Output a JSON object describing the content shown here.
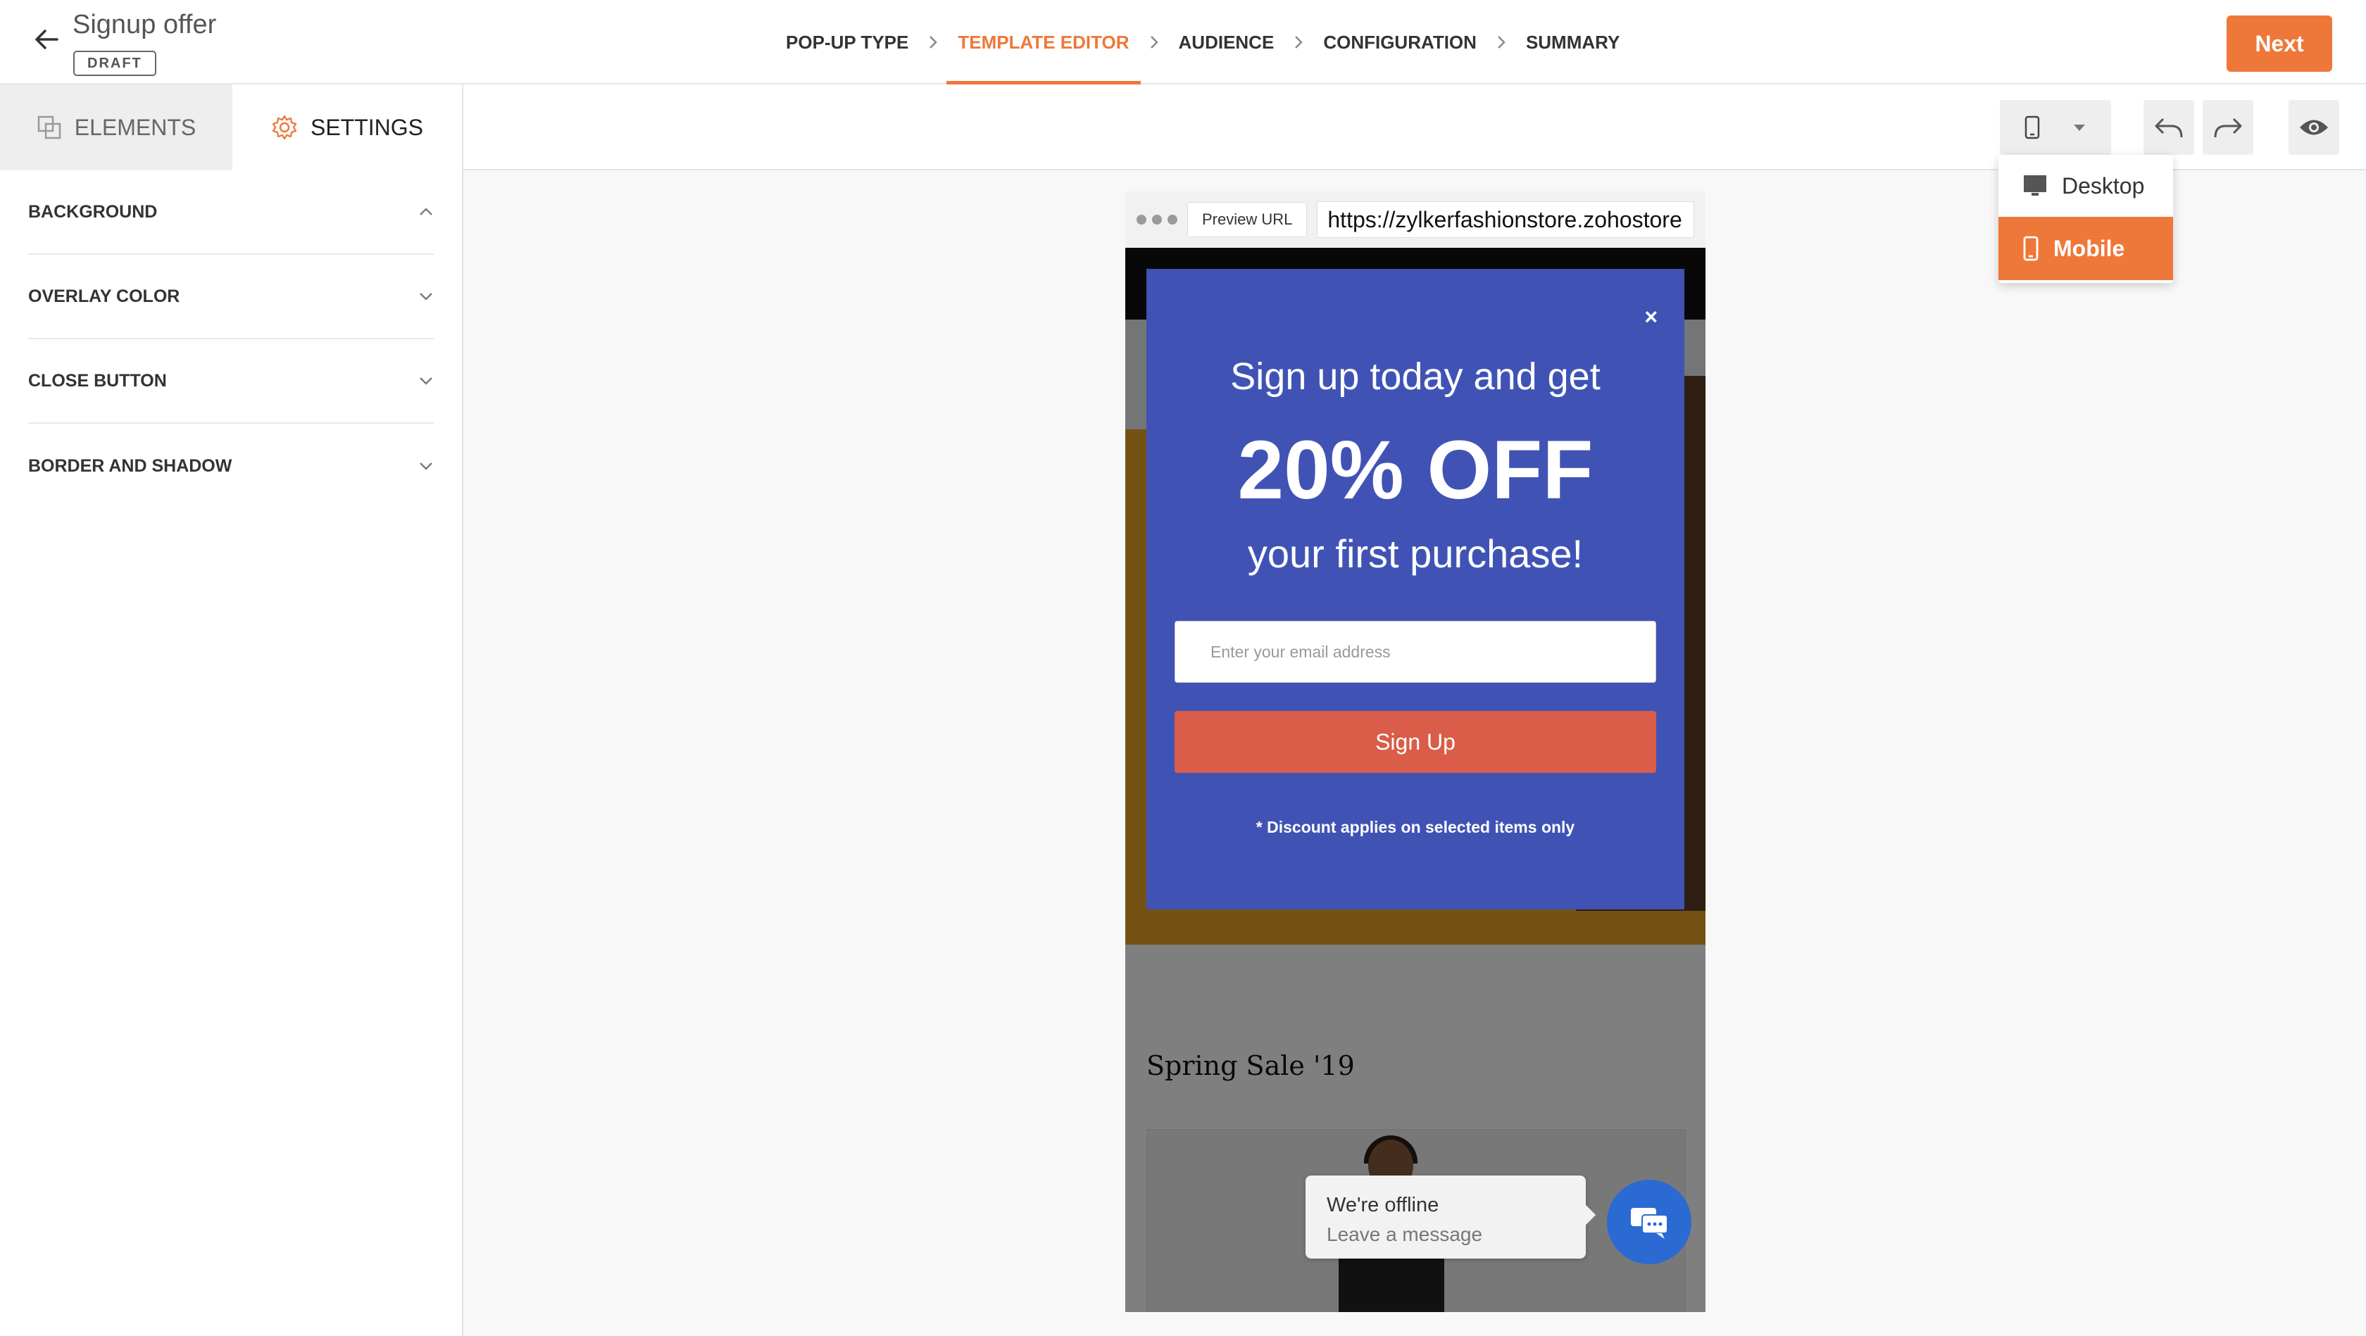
{
  "header": {
    "title": "Signup offer",
    "status_badge": "DRAFT",
    "steps": [
      {
        "label": "POP-UP TYPE"
      },
      {
        "label": "TEMPLATE EDITOR"
      },
      {
        "label": "AUDIENCE"
      },
      {
        "label": "CONFIGURATION"
      },
      {
        "label": "SUMMARY"
      }
    ],
    "active_step": "TEMPLATE EDITOR",
    "next_label": "Next"
  },
  "sidebar": {
    "tabs": [
      {
        "label": "ELEMENTS",
        "icon": "layers-icon"
      },
      {
        "label": "SETTINGS",
        "icon": "gear-icon"
      }
    ],
    "active_tab": "SETTINGS",
    "sections": [
      {
        "label": "BACKGROUND",
        "state": "expanded"
      },
      {
        "label": "OVERLAY COLOR",
        "state": "collapsed"
      },
      {
        "label": "CLOSE BUTTON",
        "state": "collapsed"
      },
      {
        "label": "BORDER AND SHADOW",
        "state": "collapsed"
      }
    ]
  },
  "toolbar": {
    "device_icon": "mobile-icon",
    "undo_icon": "undo-icon",
    "redo_icon": "redo-icon",
    "preview_icon": "eye-icon"
  },
  "device_menu": {
    "items": [
      {
        "label": "Desktop",
        "icon": "monitor-icon"
      },
      {
        "label": "Mobile",
        "icon": "mobile-icon"
      }
    ],
    "selected": "Mobile"
  },
  "preview": {
    "url_label": "Preview URL",
    "url": "https://zylkerfashionstore.zohostore",
    "popup": {
      "close_glyph": "×",
      "headline_1": "Sign up today and get",
      "headline_big": "20% OFF",
      "headline_2": "your first purchase!",
      "email_placeholder": "Enter your email address",
      "button_label": "Sign Up",
      "disclaimer": "* Discount applies on selected items only"
    },
    "site_section_title": "Spring Sale '19",
    "chat": {
      "status": "We're offline",
      "action": "Leave a message"
    }
  },
  "colors": {
    "accent": "#ee7839",
    "popup_bg": "#4053b5",
    "signup_button": "#d95d48",
    "chat_button": "#2b6ad3"
  }
}
